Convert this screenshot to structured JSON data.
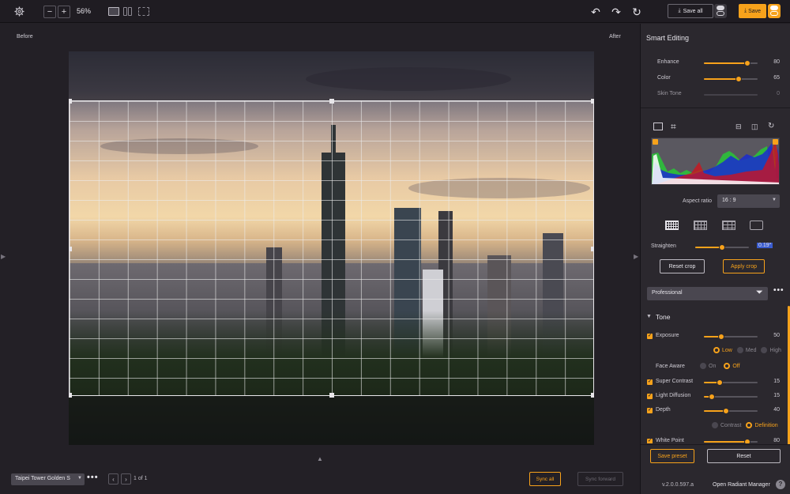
{
  "toolbar": {
    "zoom": "56%",
    "save_all_label": "Save all",
    "save_label": "Save"
  },
  "canvas": {
    "before_label": "Before",
    "after_label": "After"
  },
  "bottombar": {
    "file_name": "Taipei Tower Golden S",
    "pager": "1 of 1",
    "sync_all": "Sync all",
    "sync_forward": "Sync forward"
  },
  "panel": {
    "smart_editing_title": "Smart Editing",
    "enhance": {
      "label": "Enhance",
      "value": "80"
    },
    "color": {
      "label": "Color",
      "value": "65"
    },
    "skin_tone": {
      "label": "Skin Tone",
      "value": "0"
    },
    "aspect_ratio_label": "Aspect ratio",
    "aspect_ratio_value": "16 : 9",
    "straighten": {
      "label": "Straighten",
      "value": "0.19°"
    },
    "reset_crop": "Reset crop",
    "apply_crop": "Apply crop",
    "preset": "Professional",
    "tone_title": "Tone",
    "exposure": {
      "label": "Exposure",
      "value": "50"
    },
    "exposure_levels": [
      "Low",
      "Med",
      "High"
    ],
    "face_aware": {
      "label": "Face Aware",
      "options": [
        "On",
        "Off"
      ]
    },
    "super_contrast": {
      "label": "Super Contrast",
      "value": "15"
    },
    "light_diffusion": {
      "label": "Light Diffusion",
      "value": "15"
    },
    "depth": {
      "label": "Depth",
      "value": "40"
    },
    "depth_modes": [
      "Contrast",
      "Definition"
    ],
    "white_point": {
      "label": "White Point",
      "value": "80"
    },
    "save_preset": "Save preset",
    "reset": "Reset",
    "version": "v.2.0.0.597.a",
    "open_manager": "Open Radiant Manager"
  },
  "colors": {
    "accent": "#f7a21b",
    "panel_bg": "#2b282e",
    "app_bg": "#232026"
  }
}
